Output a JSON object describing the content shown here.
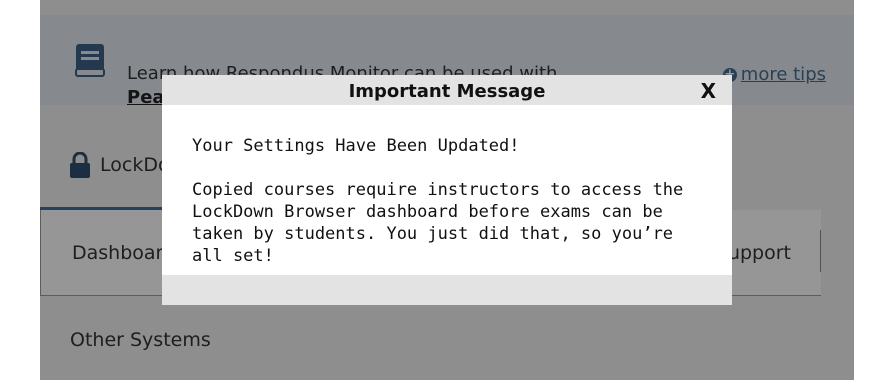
{
  "tips": {
    "text_prefix": "Learn how Respondus Monitor can be used with ",
    "link_text": "Pearson MyL",
    "more_tips": "more tips"
  },
  "tabs": {
    "lockdown": "LockDo"
  },
  "nav": {
    "dashboard": "Dashboard",
    "support": "upport"
  },
  "other_systems": "Other Systems",
  "modal": {
    "title": "Important Message",
    "close": "X",
    "line1": "Your Settings Have Been Updated!",
    "line2": "Copied courses require instructors to access the LockDown Browser dashboard before exams can be taken by students. You just did that, so you’re all set!"
  },
  "colors": {
    "accent": "#3b6fa3",
    "link": "#4a6b8c"
  }
}
